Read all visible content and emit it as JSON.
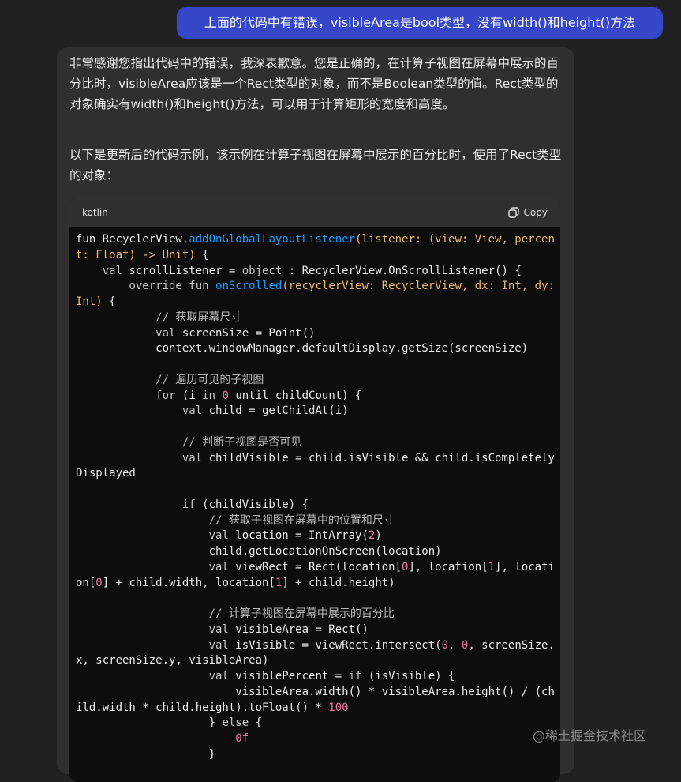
{
  "user_message": "上面的代码中有错误，visibleArea是bool类型，没有width()和height()方法",
  "assistant": {
    "paragraph1": "非常感谢您指出代码中的错误，我深表歉意。您是正确的，在计算子视图在屏幕中展示的百分比时，visibleArea应该是一个Rect类型的对象，而不是Boolean类型的值。Rect类型的对象确实有width()和height()方法，可以用于计算矩形的宽度和高度。",
    "paragraph2": "以下是更新后的代码示例，该示例在计算子视图在屏幕中展示的百分比时，使用了Rect类型的对象：",
    "code_block": {
      "language": "kotlin",
      "copy_label": "Copy",
      "lines": [
        [
          [
            "fun RecyclerView.",
            "plain"
          ],
          [
            "addOnGlobalLayoutListener",
            "fn"
          ],
          [
            "(listener: (view: View, percen",
            "type"
          ]
        ],
        [
          [
            "t: Float) -> Unit)",
            "type"
          ],
          [
            " {",
            "plain"
          ]
        ],
        [
          [
            "    val ",
            "kw"
          ],
          [
            "scrollListener = ",
            "plain"
          ],
          [
            "object",
            "kw"
          ],
          [
            " : RecyclerView.OnScrollListener() {",
            "plain"
          ]
        ],
        [
          [
            "        override fun ",
            "kw"
          ],
          [
            "onScrolled",
            "fn"
          ],
          [
            "(recyclerView: RecyclerView, dx: Int, dy:",
            "type"
          ]
        ],
        [
          [
            "Int)",
            "type"
          ],
          [
            " {",
            "plain"
          ]
        ],
        [
          [
            "            // 获取屏幕尺寸",
            "com"
          ]
        ],
        [
          [
            "            val ",
            "kw"
          ],
          [
            "screenSize = Point()",
            "plain"
          ]
        ],
        [
          [
            "            context.windowManager.defaultDisplay.getSize(screenSize)",
            "plain"
          ]
        ],
        [
          [
            "",
            "plain"
          ]
        ],
        [
          [
            "            // 遍历可见的子视图",
            "com"
          ]
        ],
        [
          [
            "            for",
            "kw"
          ],
          [
            " (i ",
            "plain"
          ],
          [
            "in ",
            "kw"
          ],
          [
            "0",
            "num"
          ],
          [
            " until childCount) {",
            "plain"
          ]
        ],
        [
          [
            "                val ",
            "kw"
          ],
          [
            "child = getChildAt(i)",
            "plain"
          ]
        ],
        [
          [
            "",
            "plain"
          ]
        ],
        [
          [
            "                // 判断子视图是否可见",
            "com"
          ]
        ],
        [
          [
            "                val ",
            "kw"
          ],
          [
            "childVisible = child.isVisible && child.isCompletely",
            "plain"
          ]
        ],
        [
          [
            "Displayed",
            "plain"
          ]
        ],
        [
          [
            "",
            "plain"
          ]
        ],
        [
          [
            "                if",
            "kw"
          ],
          [
            " (childVisible) {",
            "plain"
          ]
        ],
        [
          [
            "                    // 获取子视图在屏幕中的位置和尺寸",
            "com"
          ]
        ],
        [
          [
            "                    val ",
            "kw"
          ],
          [
            "location = IntArray(",
            "plain"
          ],
          [
            "2",
            "num"
          ],
          [
            ")",
            "plain"
          ]
        ],
        [
          [
            "                    child.getLocationOnScreen(location)",
            "plain"
          ]
        ],
        [
          [
            "                    val ",
            "kw"
          ],
          [
            "viewRect = Rect(location[",
            "plain"
          ],
          [
            "0",
            "num"
          ],
          [
            "], location[",
            "plain"
          ],
          [
            "1",
            "num"
          ],
          [
            "], locati",
            "plain"
          ]
        ],
        [
          [
            "on[",
            "plain"
          ],
          [
            "0",
            "num"
          ],
          [
            "] + child.width, location[",
            "plain"
          ],
          [
            "1",
            "num"
          ],
          [
            "] + child.height)",
            "plain"
          ]
        ],
        [
          [
            "",
            "plain"
          ]
        ],
        [
          [
            "                    // 计算子视图在屏幕中展示的百分比",
            "com"
          ]
        ],
        [
          [
            "                    val ",
            "kw"
          ],
          [
            "visibleArea = Rect()",
            "plain"
          ]
        ],
        [
          [
            "                    val ",
            "kw"
          ],
          [
            "isVisible = viewRect.intersect(",
            "plain"
          ],
          [
            "0",
            "num"
          ],
          [
            ", ",
            "plain"
          ],
          [
            "0",
            "num"
          ],
          [
            ", screenSize.",
            "plain"
          ]
        ],
        [
          [
            "x, screenSize.y, visibleArea)",
            "plain"
          ]
        ],
        [
          [
            "                    val ",
            "kw"
          ],
          [
            "visiblePercent = ",
            "plain"
          ],
          [
            "if",
            "kw"
          ],
          [
            " (isVisible) {",
            "plain"
          ]
        ],
        [
          [
            "                        visibleArea.width() * visibleArea.height() / (ch",
            "plain"
          ]
        ],
        [
          [
            "ild.width * child.height).toFloat() * ",
            "plain"
          ],
          [
            "100",
            "num"
          ]
        ],
        [
          [
            "                    } ",
            "plain"
          ],
          [
            "else",
            "kw"
          ],
          [
            " {",
            "plain"
          ]
        ],
        [
          [
            "                        ",
            "plain"
          ],
          [
            "0f",
            "num"
          ]
        ],
        [
          [
            "                    }",
            "plain"
          ]
        ]
      ]
    }
  },
  "watermark": "@稀土掘金技术社区",
  "colors": {
    "user_bubble": "#3646c8",
    "background": "#212121",
    "assistant_bg": "#2f2f2f",
    "code_bg": "#0d0d0d",
    "function_name": "#19a0ff",
    "type": "#e9b96e",
    "number": "#e87aa5"
  },
  "icons": {
    "copy": "copy-icon"
  }
}
